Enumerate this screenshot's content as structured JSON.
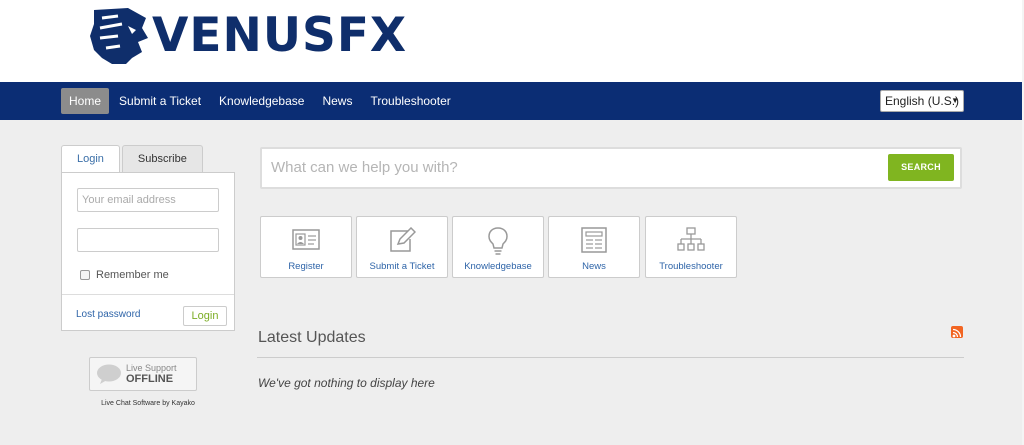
{
  "brand": {
    "logo_text": "VENUSFX",
    "color": "#0f2e6b"
  },
  "nav": {
    "items": [
      {
        "label": "Home",
        "active": true
      },
      {
        "label": "Submit a Ticket"
      },
      {
        "label": "Knowledgebase"
      },
      {
        "label": "News"
      },
      {
        "label": "Troubleshooter"
      }
    ],
    "language": "English (U.S.)",
    "background": "#0b2d74"
  },
  "login_panel": {
    "tabs": [
      "Login",
      "Subscribe"
    ],
    "email_placeholder": "Your email address",
    "password_value": "",
    "remember_label": "Remember me",
    "lost_password": "Lost password",
    "login_button": "Login"
  },
  "live_support": {
    "line1": "Live Support",
    "line2": "OFFLINE",
    "powered": "Live Chat Software by Kayako"
  },
  "search": {
    "placeholder": "What can we help you with?",
    "button": "SEARCH",
    "button_color": "#80b520"
  },
  "tiles": [
    {
      "label": "Register",
      "icon": "id-card-icon"
    },
    {
      "label": "Submit a Ticket",
      "icon": "pencil-square-icon"
    },
    {
      "label": "Knowledgebase",
      "icon": "lightbulb-icon"
    },
    {
      "label": "News",
      "icon": "newspaper-icon"
    },
    {
      "label": "Troubleshooter",
      "icon": "flowchart-icon"
    }
  ],
  "updates": {
    "title": "Latest Updates",
    "empty_message": "We've got nothing to display here",
    "rss_icon": "rss-icon"
  }
}
